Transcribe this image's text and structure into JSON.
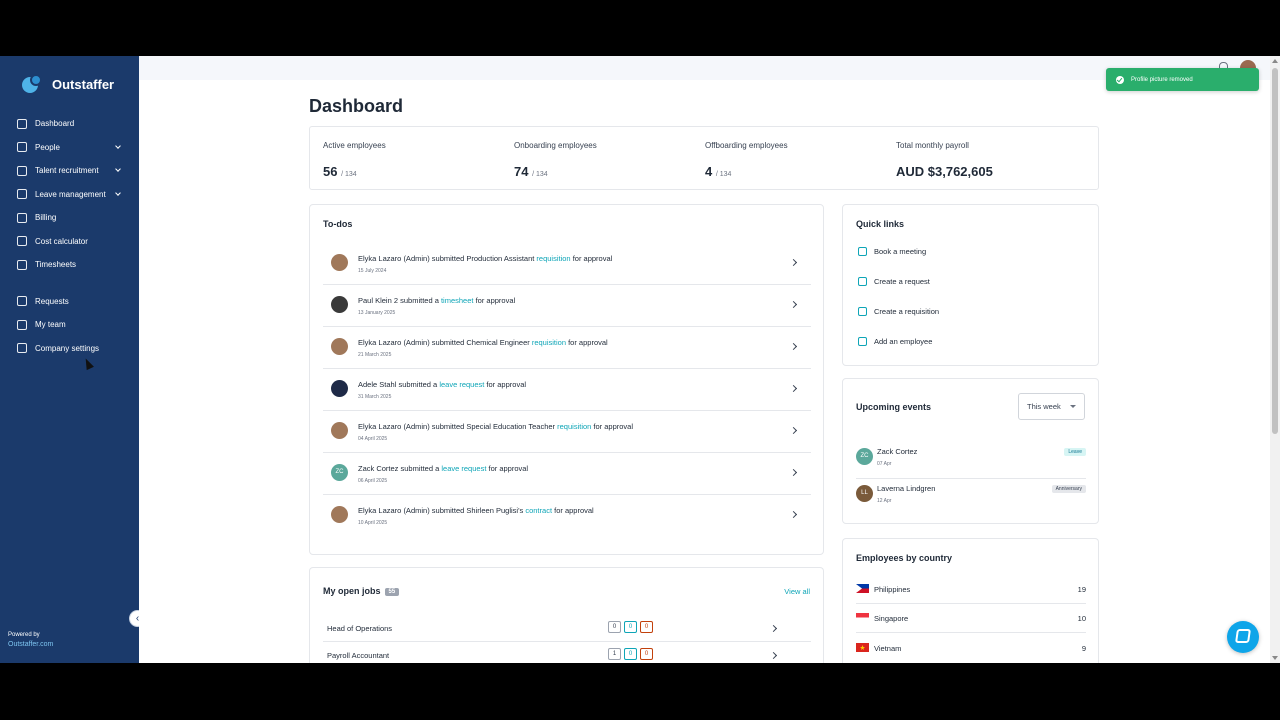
{
  "app": {
    "logo": "Outstaffer"
  },
  "sidebar": {
    "items": [
      {
        "label": "Dashboard",
        "chev": false
      },
      {
        "label": "People",
        "chev": true
      },
      {
        "label": "Talent recruitment",
        "chev": true
      },
      {
        "label": "Leave management",
        "chev": true
      },
      {
        "label": "Billing",
        "chev": false
      },
      {
        "label": "Cost calculator",
        "chev": false
      },
      {
        "label": "Timesheets",
        "chev": false
      }
    ],
    "items2": [
      {
        "label": "Requests"
      },
      {
        "label": "My team"
      },
      {
        "label": "Company settings"
      }
    ],
    "powered_by": "Powered by",
    "powered_link": "Outstaffer.com"
  },
  "toast": {
    "text": "Profile picture removed"
  },
  "page": {
    "title": "Dashboard"
  },
  "stats": [
    {
      "label": "Active employees",
      "value": "56",
      "total": "/ 134"
    },
    {
      "label": "Onboarding employees",
      "value": "74",
      "total": "/ 134"
    },
    {
      "label": "Offboarding employees",
      "value": "4",
      "total": "/ 134"
    },
    {
      "label": "Total monthly payroll",
      "value": "AUD $3,762,605",
      "total": ""
    }
  ],
  "todos": {
    "title": "To-dos",
    "items": [
      {
        "pre": "Elyka Lazaro (Admin) submitted Production Assistant ",
        "link": "requisition",
        "post": " for approval",
        "date": "15 July 2024",
        "initials": "",
        "av": ""
      },
      {
        "pre": "Paul Klein 2 submitted a ",
        "link": "timesheet",
        "post": " for approval",
        "date": "13 January 2025",
        "initials": "",
        "av": "dark"
      },
      {
        "pre": "Elyka Lazaro (Admin) submitted Chemical Engineer ",
        "link": "requisition",
        "post": " for approval",
        "date": "21 March 2025",
        "initials": "",
        "av": ""
      },
      {
        "pre": "Adele Stahl submitted a ",
        "link": "leave request",
        "post": " for approval",
        "date": "31 March 2025",
        "initials": "",
        "av": "navy"
      },
      {
        "pre": "Elyka Lazaro (Admin) submitted Special Education Teacher ",
        "link": "requisition",
        "post": " for approval",
        "date": "04 April 2025",
        "initials": "",
        "av": ""
      },
      {
        "pre": "Zack Cortez submitted a ",
        "link": "leave request",
        "post": " for approval",
        "date": "06 April 2025",
        "initials": "ZC",
        "av": "teal"
      },
      {
        "pre": "Elyka Lazaro (Admin) submitted Shirleen Puglisi's ",
        "link": "contract",
        "post": " for approval",
        "date": "10 April 2025",
        "initials": "",
        "av": ""
      }
    ]
  },
  "jobs": {
    "title": "My open jobs",
    "count": "55",
    "view_all": "View all",
    "items": [
      {
        "name": "Head of Operations",
        "a": "0",
        "b": "0",
        "c": "0"
      },
      {
        "name": "Payroll Accountant",
        "a": "1",
        "b": "0",
        "c": "0"
      }
    ]
  },
  "quick_links": {
    "title": "Quick links",
    "items": [
      {
        "label": "Book a meeting",
        "icon": "send-icon"
      },
      {
        "label": "Create a request",
        "icon": "document-icon"
      },
      {
        "label": "Create a requisition",
        "icon": "file-icon"
      },
      {
        "label": "Add an employee",
        "icon": "add-user-icon"
      }
    ]
  },
  "events": {
    "title": "Upcoming events",
    "filter": "This week",
    "items": [
      {
        "name": "Zack Cortez",
        "date": "07 Apr",
        "tag": "Leave",
        "initials": "ZC"
      },
      {
        "name": "Laverna Lindgren",
        "date": "12 Apr",
        "tag": "Anniversary",
        "initials": "LL"
      }
    ]
  },
  "countries": {
    "title": "Employees by country",
    "items": [
      {
        "name": "Philippines",
        "count": "19"
      },
      {
        "name": "Singapore",
        "count": "10"
      },
      {
        "name": "Vietnam",
        "count": "9"
      }
    ]
  }
}
